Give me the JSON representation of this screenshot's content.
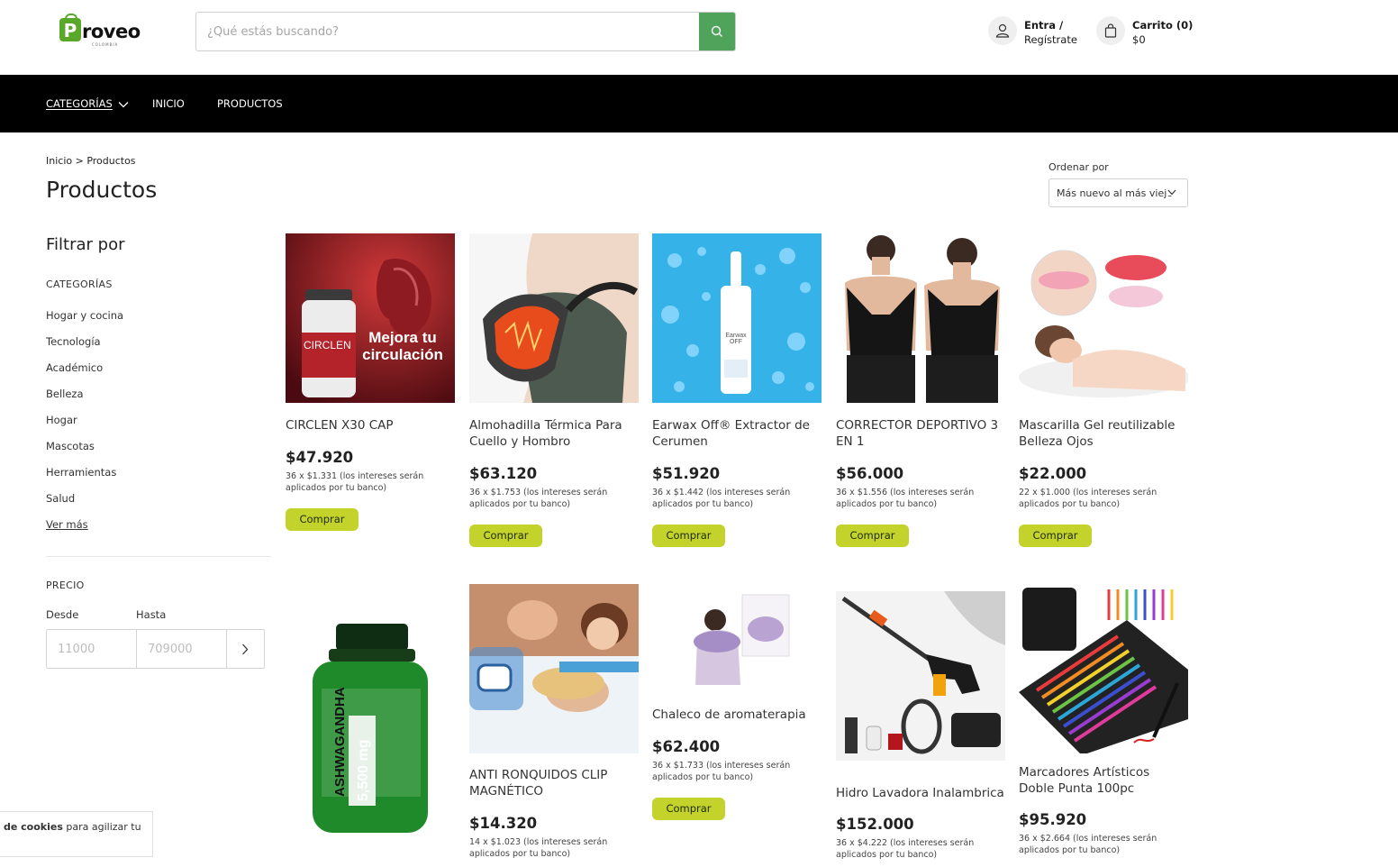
{
  "header": {
    "logo_text": "roveo",
    "logo_letter": "P",
    "logo_sub": "COLOMBIA",
    "search_placeholder": "¿Qué estás buscando?",
    "account_line1": "Entra /",
    "account_line2": "Regístrate",
    "cart_line1": "Carrito (0)",
    "cart_line2": "$0"
  },
  "nav": {
    "categories": "CATEGORÍAS",
    "home": "INICIO",
    "products": "PRODUCTOS"
  },
  "breadcrumb": "Inicio > Productos",
  "page_title": "Productos",
  "sort": {
    "label": "Ordenar por",
    "selected": "Más nuevo al más viejo"
  },
  "sidebar": {
    "filter_title": "Filtrar por",
    "categories_heading": "CATEGORÍAS",
    "categories": [
      "Hogar y cocina",
      "Tecnología",
      "Académico",
      "Belleza",
      "Hogar",
      "Mascotas",
      "Herramientas",
      "Salud"
    ],
    "see_more": "Ver más",
    "price_heading": "PRECIO",
    "from_label": "Desde",
    "to_label": "Hasta",
    "from_placeholder": "11000",
    "to_placeholder": "709000"
  },
  "products": [
    {
      "name": "CIRCLEN X30 CAP",
      "price": "$47.920",
      "installments": "36 x $1.331 (los intereses serán aplicados por tu banco)",
      "button": "Comprar",
      "image_text": "Mejora tu circulación",
      "image_brand": "CIRCLEN"
    },
    {
      "name": "Almohadilla Térmica Para Cuello y Hombro",
      "price": "$63.120",
      "installments": "36 x $1.753 (los intereses serán aplicados por tu banco)",
      "button": "Comprar"
    },
    {
      "name": "Earwax Off® Extractor de Cerumen",
      "price": "$51.920",
      "installments": "36 x $1.442 (los intereses serán aplicados por tu banco)",
      "button": "Comprar",
      "image_text": "Earwax OFF"
    },
    {
      "name": "CORRECTOR DEPORTIVO 3 EN 1",
      "price": "$56.000",
      "installments": "36 x $1.556 (los intereses serán aplicados por tu banco)",
      "button": "Comprar"
    },
    {
      "name": "Mascarilla Gel reutilizable Belleza Ojos",
      "price": "$22.000",
      "installments": "22 x $1.000 (los intereses serán aplicados por tu banco)",
      "button": "Comprar"
    },
    {
      "name": "",
      "price": "",
      "installments": "",
      "button": "",
      "image_text": "ASHWAGANDHA",
      "image_sub": "5,500 mg"
    },
    {
      "name": "ANTI RONQUIDOS CLIP MAGNÉTICO",
      "price": "$14.320",
      "installments": "14 x $1.023 (los intereses serán aplicados por tu banco)",
      "button": ""
    },
    {
      "name": "Chaleco de aromaterapia",
      "price": "$62.400",
      "installments": "36 x $1.733 (los intereses serán aplicados por tu banco)",
      "button": "Comprar"
    },
    {
      "name": "Hidro Lavadora Inalambrica",
      "price": "$152.000",
      "installments": "36 x $4.222 (los intereses serán aplicados por tu banco)",
      "button": ""
    },
    {
      "name": "Marcadores Artísticos Doble Punta 100pc",
      "price": "$95.920",
      "installments": "36 x $2.664 (los intereses serán aplicados por tu banco)",
      "button": ""
    }
  ],
  "cookie": {
    "bold": "de cookies",
    "rest": " para agilizar tu"
  },
  "colors": {
    "accent_green": "#4fa35b",
    "button_lime": "#c3d32b",
    "nav_bg": "#000000",
    "logo_green": "#5aa82a"
  }
}
